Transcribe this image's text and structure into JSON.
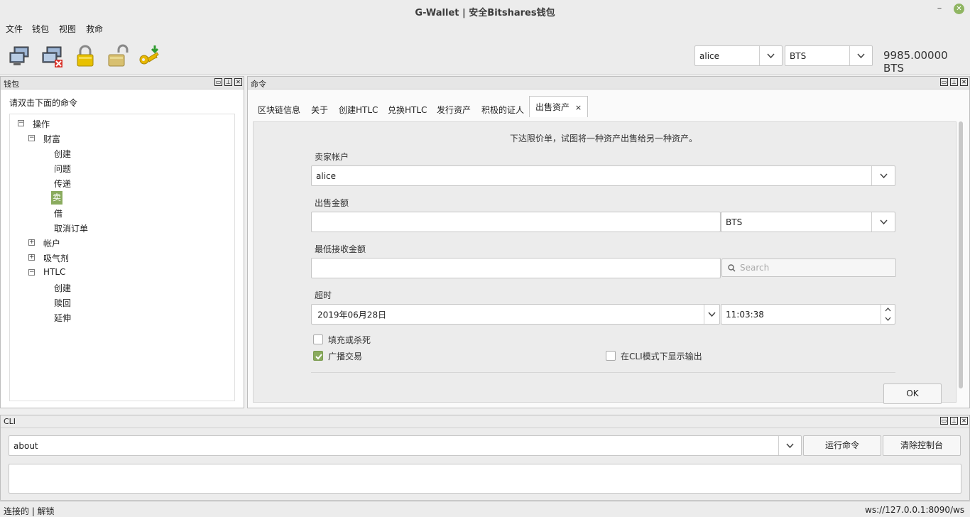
{
  "window": {
    "title": "G-Wallet | 安全Bitshares钱包",
    "minimize": "–",
    "close": "✕"
  },
  "menu": [
    "文件",
    "钱包",
    "视图",
    "救命"
  ],
  "toolbar": {
    "icons": [
      "network-connect-icon",
      "network-disconnect-icon",
      "lock-icon",
      "unlock-icon",
      "import-key-icon"
    ],
    "account": "alice",
    "asset": "BTS",
    "balance": "9985.00000 BTS"
  },
  "wallet_panel": {
    "title": "钱包",
    "hint": "请双击下面的命令",
    "tree": {
      "root": "操作",
      "wealth": "财富",
      "wealth_items": [
        "创建",
        "问题",
        "传递",
        "卖",
        "借",
        "取消订单"
      ],
      "account": "帐户",
      "absorber": "吸气剂",
      "htlc": "HTLC",
      "htlc_items": [
        "创建",
        "赎回",
        "延伸"
      ]
    }
  },
  "command_panel": {
    "title": "命令",
    "tabs": [
      "区块链信息",
      "关于",
      "创建HTLC",
      "兑换HTLC",
      "发行资产",
      "积极的证人",
      "出售资产"
    ],
    "active_tab_close": "×",
    "form": {
      "description": "下达限价单，试图将一种资产出售给另一种资产。",
      "seller_label": "卖家帐户",
      "seller_value": "alice",
      "sell_amount_label": "出售金额",
      "sell_amount_value": "",
      "sell_asset": "BTS",
      "min_receive_label": "最低接收金额",
      "min_receive_value": "",
      "search_placeholder": "Search",
      "timeout_label": "超时",
      "date_value": "2019年06月28日",
      "time_value": "11:03:38",
      "fill_or_kill_label": "填充或杀死",
      "fill_or_kill_checked": false,
      "broadcast_label": "广播交易",
      "broadcast_checked": true,
      "cli_output_label": "在CLI模式下显示输出",
      "cli_output_checked": false,
      "ok_label": "OK"
    }
  },
  "cli_panel": {
    "title": "CLI",
    "command_value": "about",
    "run_label": "运行命令",
    "clear_label": "清除控制台",
    "output": ""
  },
  "status": {
    "left": "连接的 | 解锁",
    "right": "ws://127.0.0.1:8090/ws"
  },
  "colors": {
    "accent": "#8aab5e",
    "close": "#8fb562"
  }
}
